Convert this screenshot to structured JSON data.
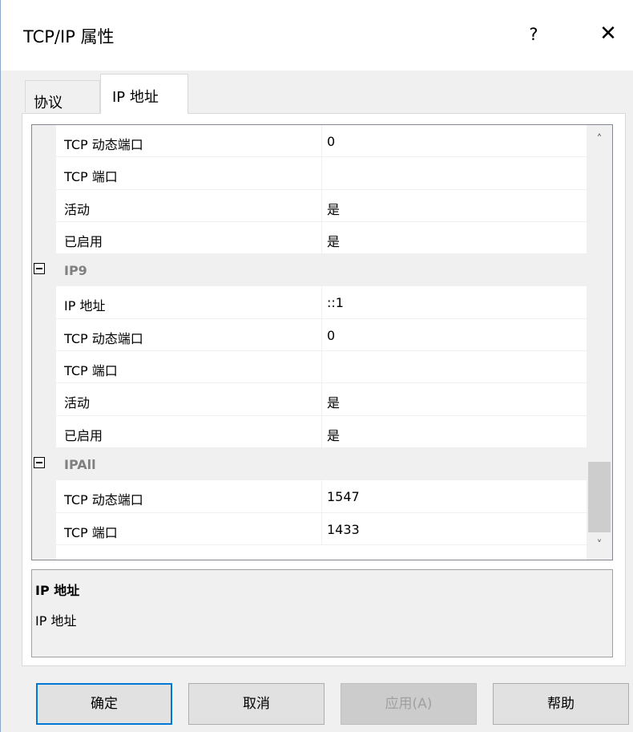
{
  "window": {
    "title": "TCP/IP 属性",
    "help_label": "?",
    "close_label": "✕"
  },
  "tabs": [
    {
      "label": "协议"
    },
    {
      "label": "IP 地址"
    }
  ],
  "grid": {
    "rows": [
      {
        "name": "TCP 动态端口",
        "value": "0"
      },
      {
        "name": "TCP 端口",
        "value": ""
      },
      {
        "name": "活动",
        "value": "是"
      },
      {
        "name": "已启用",
        "value": "是"
      },
      {
        "category": "IP9"
      },
      {
        "name": "IP 地址",
        "value": "::1"
      },
      {
        "name": "TCP 动态端口",
        "value": "0"
      },
      {
        "name": "TCP 端口",
        "value": ""
      },
      {
        "name": "活动",
        "value": "是"
      },
      {
        "name": "已启用",
        "value": "是"
      },
      {
        "category": "IPAll"
      },
      {
        "name": "TCP 动态端口",
        "value": "1547"
      },
      {
        "name": "TCP 端口",
        "value": "1433"
      }
    ],
    "scroll_up_icon": "chevron-up-icon",
    "scroll_down_icon": "chevron-down-icon"
  },
  "description": {
    "title": "IP 地址",
    "text": "IP 地址"
  },
  "buttons": {
    "ok": "确定",
    "cancel": "取消",
    "apply": "应用(A)",
    "help": "帮助"
  },
  "colors": {
    "accent": "#0078d7",
    "category_text": "#808080",
    "panel_bg": "#f0f0f0"
  }
}
